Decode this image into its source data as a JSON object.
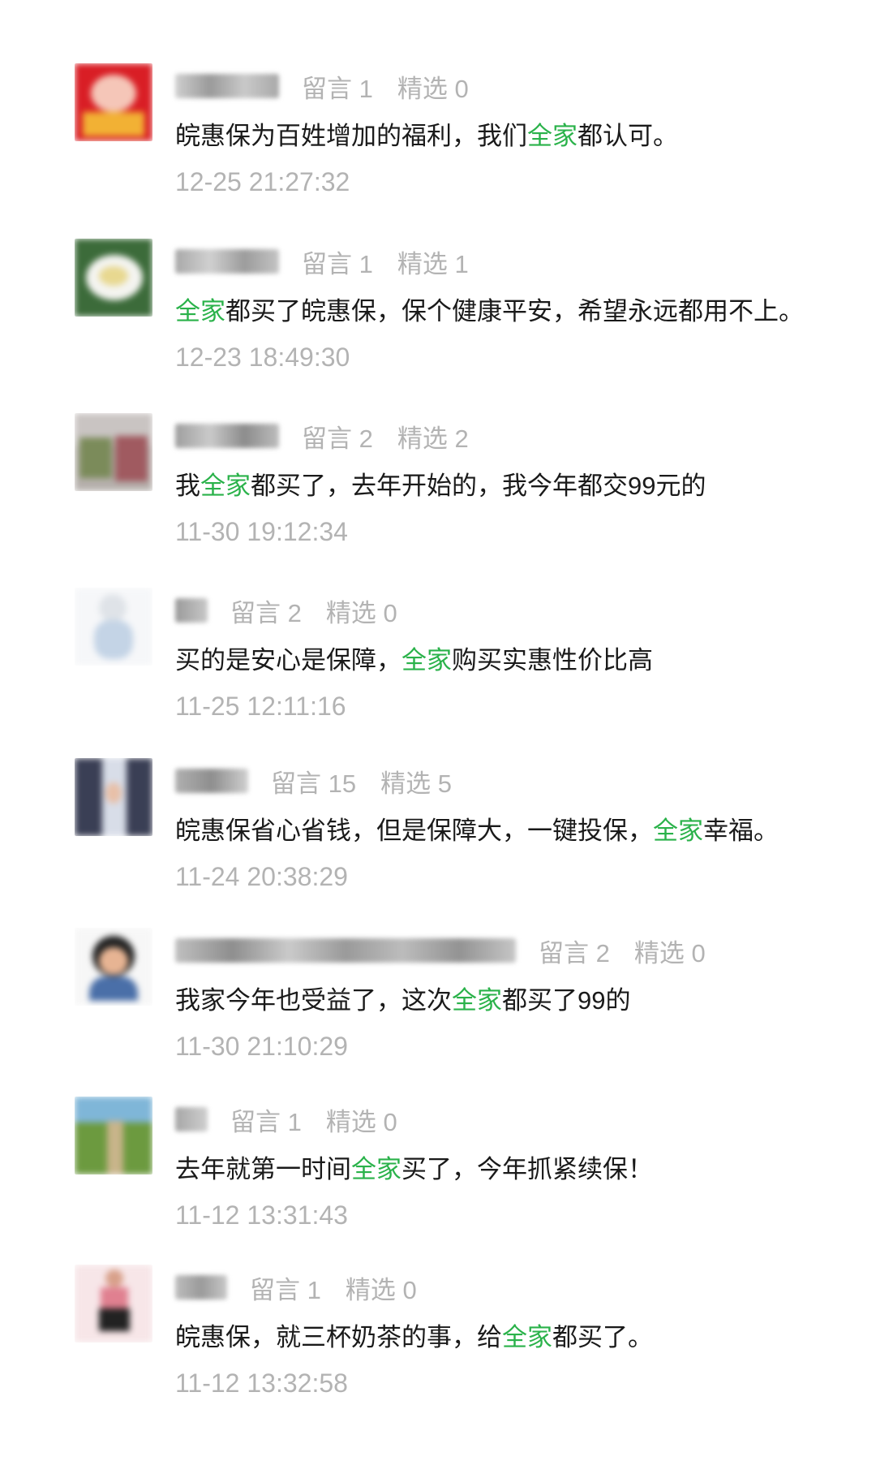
{
  "comments": [
    {
      "stats": {
        "messages": "留言 1",
        "selected": "精选 0"
      },
      "text_before": "皖惠保为百姓增加的福利，我们",
      "highlight": "全家",
      "text_after": "都认可。",
      "time": "12-25 21:27:32",
      "avatar_icon": "red-calendar-avatar",
      "colors": {
        "avatar": "#d91e25"
      }
    },
    {
      "stats": {
        "messages": "留言 1",
        "selected": "精选 1"
      },
      "text_before": "",
      "highlight": "全家",
      "text_after": "都买了皖惠保，保个健康平安，希望永远都用不上。",
      "time": "12-23 18:49:30",
      "avatar_icon": "white-flower-avatar",
      "colors": {
        "avatar": "#3c6b3a"
      }
    },
    {
      "stats": {
        "messages": "留言 2",
        "selected": "精选 2"
      },
      "text_before": "我",
      "highlight": "全家",
      "text_after": "都买了，去年开始的，我今年都交99元的",
      "time": "11-30 19:12:34",
      "avatar_icon": "garden-avatar",
      "colors": {
        "avatar": "#8b7d7a"
      }
    },
    {
      "stats": {
        "messages": "留言 2",
        "selected": "精选 0"
      },
      "text_before": "买的是安心是保障，",
      "highlight": "全家",
      "text_after": "购买实惠性价比高",
      "time": "11-25 12:11:16",
      "avatar_icon": "white-figure-avatar",
      "colors": {
        "avatar": "#e8ecf2"
      }
    },
    {
      "stats": {
        "messages": "留言 15",
        "selected": "精选 5"
      },
      "text_before": "皖惠保省心省钱，但是保障大，一键投保，",
      "highlight": "全家",
      "text_after": "幸福。",
      "time": "11-24 20:38:29",
      "avatar_icon": "portrait-avatar",
      "colors": {
        "avatar": "#5a6a8c"
      }
    },
    {
      "stats": {
        "messages": "留言 2",
        "selected": "精选 0"
      },
      "text_before": "我家今年也受益了，这次",
      "highlight": "全家",
      "text_after": "都买了99的",
      "time": "11-30 21:10:29",
      "avatar_icon": "child-avatar",
      "colors": {
        "avatar": "#4a6fa8"
      }
    },
    {
      "stats": {
        "messages": "留言 1",
        "selected": "精选 0"
      },
      "text_before": "去年就第一时间",
      "highlight": "全家",
      "text_after": "买了，今年抓紧续保！",
      "time": "11-12 13:31:43",
      "avatar_icon": "field-landscape-avatar",
      "colors": {
        "avatar": "#5f8c3c"
      }
    },
    {
      "stats": {
        "messages": "留言 1",
        "selected": "精选 0"
      },
      "text_before": "皖惠保，就三杯奶茶的事，给",
      "highlight": "全家",
      "text_after": "都买了。",
      "time": "11-12 13:32:58",
      "avatar_icon": "doll-avatar",
      "colors": {
        "avatar": "#f2dde0"
      }
    }
  ],
  "colors": {
    "highlight": "#2ab24a",
    "meta_text": "#b3b3b3",
    "body_text": "#1a1a1a"
  }
}
